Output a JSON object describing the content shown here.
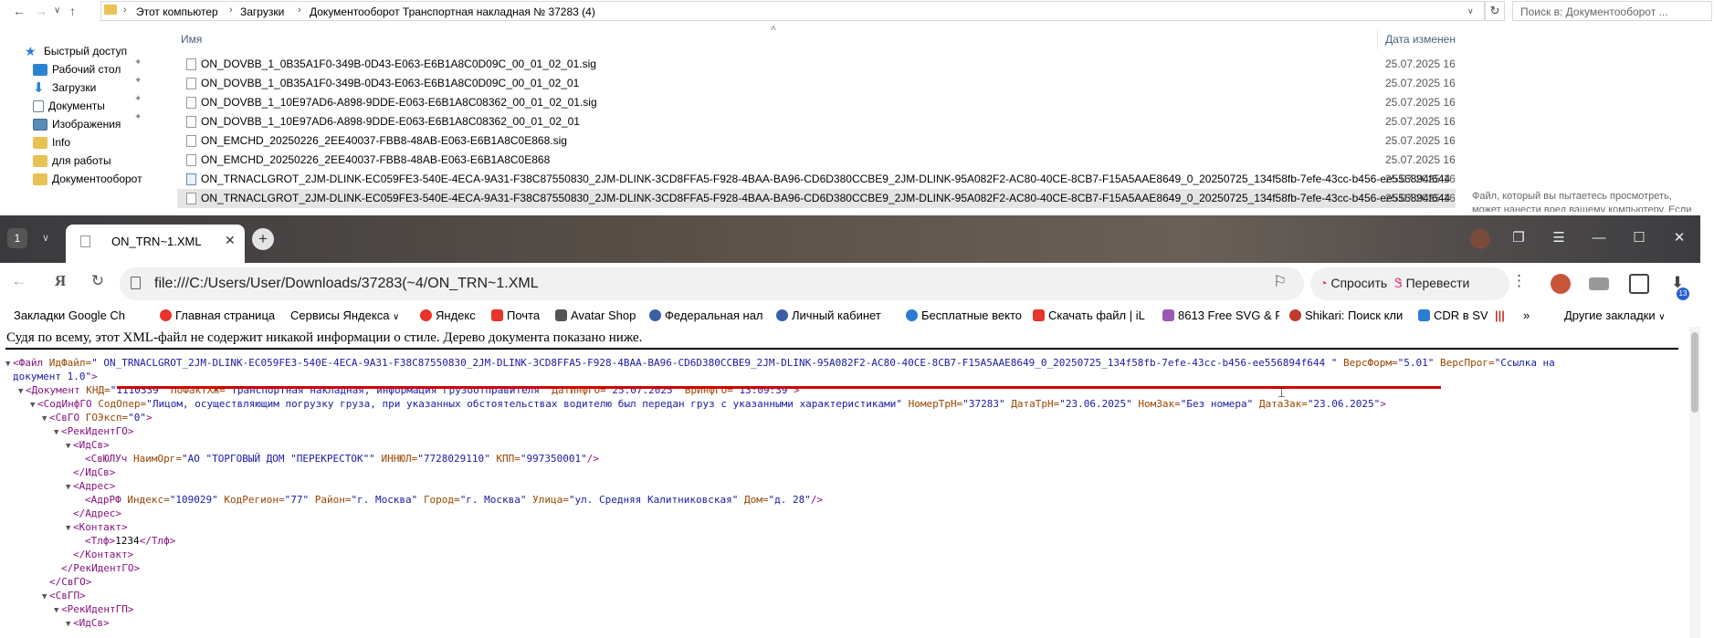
{
  "explorer": {
    "breadcrumb": [
      "Этот компьютер",
      "Загрузки",
      "Документооборот Транспортная накладная № 37283 (4)"
    ],
    "search_placeholder": "Поиск в: Документооборот ...",
    "quick_access": [
      {
        "label": "Быстрый доступ",
        "icon": "star-icon",
        "pinned": false
      },
      {
        "label": "Рабочий стол",
        "icon": "desktop-folder-icon",
        "pinned": true
      },
      {
        "label": "Загрузки",
        "icon": "download-folder-icon",
        "pinned": true
      },
      {
        "label": "Документы",
        "icon": "documents-folder-icon",
        "pinned": true
      },
      {
        "label": "Изображения",
        "icon": "pictures-folder-icon",
        "pinned": true
      },
      {
        "label": "Info",
        "icon": "folder-icon",
        "pinned": false
      },
      {
        "label": "для работы",
        "icon": "folder-icon",
        "pinned": false
      },
      {
        "label": "Документооборот",
        "icon": "folder-icon",
        "pinned": false
      }
    ],
    "columns": {
      "name": "Имя",
      "date": "Дата изменен"
    },
    "files": [
      {
        "name": "ON_DOVBB_1_0B35A1F0-349B-0D43-E063-E6B1A8C0D09C_00_01_02_01.sig",
        "date": "25.07.2025 16:",
        "selected": false
      },
      {
        "name": "ON_DOVBB_1_0B35A1F0-349B-0D43-E063-E6B1A8C0D09C_00_01_02_01",
        "date": "25.07.2025 16:",
        "selected": false
      },
      {
        "name": "ON_DOVBB_1_10E97AD6-A898-9DDE-E063-E6B1A8C08362_00_01_02_01.sig",
        "date": "25.07.2025 16:",
        "selected": false
      },
      {
        "name": "ON_DOVBB_1_10E97AD6-A898-9DDE-E063-E6B1A8C08362_00_01_02_01",
        "date": "25.07.2025 16:",
        "selected": false
      },
      {
        "name": "ON_EMCHD_20250226_2EE40037-FBB8-48AB-E063-E6B1A8C0E868.sig",
        "date": "25.07.2025 16:",
        "selected": false
      },
      {
        "name": "ON_EMCHD_20250226_2EE40037-FBB8-48AB-E063-E6B1A8C0E868",
        "date": "25.07.2025 16:",
        "selected": false
      },
      {
        "name": "ON_TRNACLGROT_2JM-DLINK-EC059FE3-540E-4ECA-9A31-F38C87550830_2JM-DLINK-3CD8FFA5-F928-4BAA-BA96-CD6D380CCBE9_2JM-DLINK-95A082F2-AC80-40CE-8CB7-F15A5AAE8649_0_20250725_134f58fb-7efe-43cc-b456-ee556894f644",
        "date": "25.07.2025 16:",
        "selected": false
      },
      {
        "name": "ON_TRNACLGROT_2JM-DLINK-EC059FE3-540E-4ECA-9A31-F38C87550830_2JM-DLINK-3CD8FFA5-F928-4BAA-BA96-CD6D380CCBE9_2JM-DLINK-95A082F2-AC80-40CE-8CB7-F15A5AAE8649_0_20250725_134f58fb-7efe-43cc-b456-ee556894f644",
        "date": "25.07.2025 16:",
        "selected": true
      }
    ],
    "preview_message_line1": "Файл, который вы пытаетесь просмотреть,",
    "preview_message_line2": "может нанести вред вашему компьютеру. Если"
  },
  "browser": {
    "tab_count": "1",
    "tab_title": "ON_TRN~1.XML",
    "url": "file:///C:/Users/User/Downloads/37283(~4/ON_TRN~1.XML",
    "ask_label": "Спросить",
    "translate_label": "Перевести",
    "downloads_badge": "13",
    "bookmarks": [
      {
        "label": "Закладки Google Ch",
        "icon": "none"
      },
      {
        "label": "Главная страница",
        "icon": "yandex-red-icon"
      },
      {
        "label": "Сервисы Яндекса",
        "icon": "none"
      },
      {
        "label": "Яндекс",
        "icon": "yandex-icon"
      },
      {
        "label": "Почта",
        "icon": "mail-icon"
      },
      {
        "label": "Avatar Shop",
        "icon": "shop-icon"
      },
      {
        "label": "Федеральная нал",
        "icon": "tax-icon"
      },
      {
        "label": "Личный кабинет",
        "icon": "account-icon"
      },
      {
        "label": "Бесплатные векто",
        "icon": "vector-icon"
      },
      {
        "label": "Скачать файл | iL",
        "icon": "ilovepdf-icon"
      },
      {
        "label": "8613 Free SVG & P",
        "icon": "svg-icon"
      },
      {
        "label": "Shikari: Поиск кли",
        "icon": "shikari-icon"
      },
      {
        "label": "CDR в SV",
        "icon": "cdr-icon"
      }
    ],
    "other_bookmarks": "Другие закладки",
    "xml_notice": "Судя по всему, этот XML-файл не содержит никакой информации о стиле. Дерево документа показано ниже."
  },
  "xml": {
    "l1": {
      "tag": "<Файл",
      "a1": "ИдФайл=",
      "v1": "\" ON_TRNACLGROT_2JM-DLINK-EC059FE3-540E-4ECA-9A31-F38C87550830_2JM-DLINK-3CD8FFA5-F928-4BAA-BA96-CD6D380CCBE9_2JM-DLINK-95A082F2-AC80-40CE-8CB7-F15A5AAE8649_0_20250725_134f58fb-7efe-43cc-b456-ee556894f644 \"",
      "a2": "ВерсФорм=",
      "v2": "\"5.01\"",
      "a3": "ВерсПрог=",
      "v3": "\"Ссылка на",
      "v3b": "документ 1.0\"",
      "close": ">"
    },
    "l2": {
      "tag": "<Документ",
      "a1": "КНД=",
      "v1": "\"1110339\"",
      "a2": "ПоФактХЖ=",
      "v2": "\"Транспортная накладная, информация грузоотправителя\"",
      "a3": "ДатИнфГО=",
      "v3": "\"25.07.2025\"",
      "a4": "ВрИнфГО=",
      "v4": "\"13:09:39\"",
      "close": ">"
    },
    "l3": {
      "tag": "<СодИнфГО",
      "a1": "СодОпер=",
      "v1": "\"Лицом, осуществляющим погрузку груза, при указанных обстоятельствах водителю был передан груз с указанными характеристиками\"",
      "a2": "НомерТрН=",
      "v2": "\"37283\"",
      "a3": "ДатаТрН=",
      "v3": "\"23.06.2025\"",
      "a4": "НомЗак=",
      "v4": "\"Без номера\"",
      "a5": "ДатаЗак=",
      "v5": "\"23.06.2025\"",
      "close": ">"
    },
    "l4": {
      "tag": "<СвГО",
      "a1": "ГОЭксп=",
      "v1": "\"0\"",
      "close": ">"
    },
    "l5": "<РекИдентГО>",
    "l6": "<ИдСв>",
    "l7": {
      "tag": "<СвЮЛУч",
      "a1": "НаимОрг=",
      "v1": "\"АО \"ТОРГОВЫЙ ДОМ \"ПЕРЕКРЕСТОК\"\"",
      "a2": "ИННЮЛ=",
      "v2": "\"7728029110\"",
      "a3": "КПП=",
      "v3": "\"997350001\"",
      "close": "/>"
    },
    "l8": "</ИдСв>",
    "l9": "<Адрес>",
    "l10": {
      "tag": "<АдрРФ",
      "a1": "Индекс=",
      "v1": "\"109029\"",
      "a2": "КодРегион=",
      "v2": "\"77\"",
      "a3": "Район=",
      "v3": "\"г. Москва\"",
      "a4": "Город=",
      "v4": "\"г. Москва\"",
      "a5": "Улица=",
      "v5": "\"ул. Средняя Калитниковская\"",
      "a6": "Дом=",
      "v6": "\"д. 28\"",
      "close": "/>"
    },
    "l11": "</Адрес>",
    "l12": "<Контакт>",
    "l13": {
      "open": "<Тлф>",
      "text": "1234",
      "close": "</Тлф>"
    },
    "l14": "</Контакт>",
    "l15": "</РекИдентГО>",
    "l16": "</СвГО>",
    "l17": "<СвГП>",
    "l18": "<РекИдентГП>",
    "l19": "<ИдСв>"
  },
  "colors": {
    "xml_tag": "#881280",
    "xml_attr": "#994500",
    "xml_value": "#1a1aa6",
    "underline": "#d40000"
  }
}
